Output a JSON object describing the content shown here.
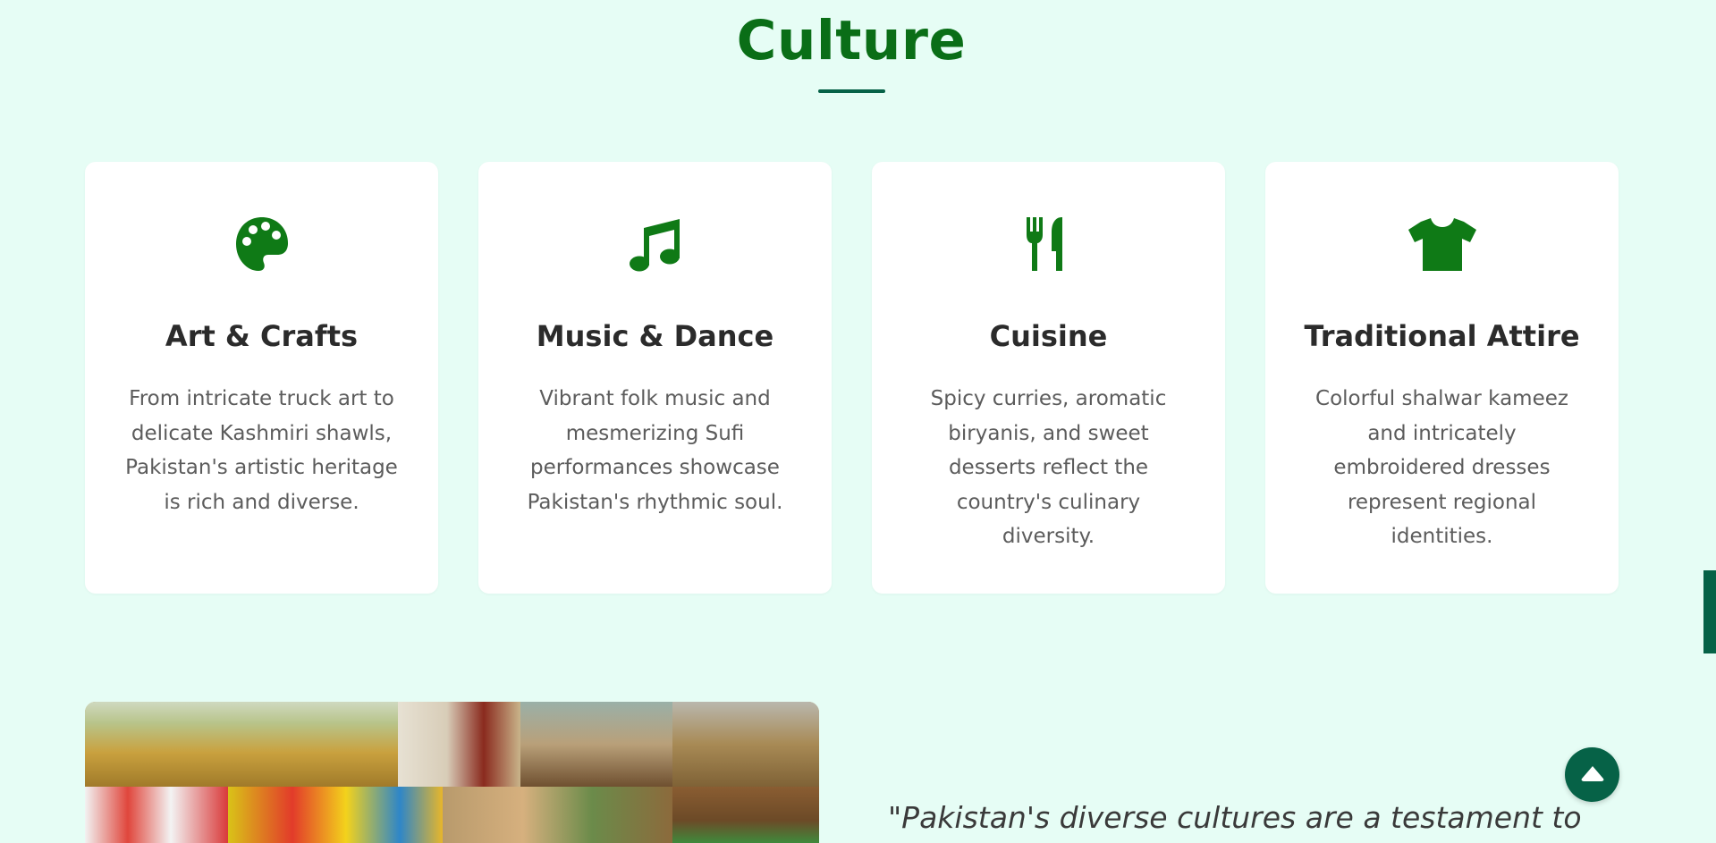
{
  "culture_section": {
    "title": "Culture",
    "colors": {
      "title": "#0a6e17",
      "accent": "#066247",
      "icon": "#0f7a16",
      "background": "#e6fdf5",
      "card": "#ffffff"
    },
    "cards": [
      {
        "icon": "palette-icon",
        "title": "Art & Crafts",
        "text": "From intricate truck art to delicate Kashmiri shawls, Pakistan's artistic heritage is rich and diverse."
      },
      {
        "icon": "music-note-icon",
        "title": "Music & Dance",
        "text": "Vibrant folk music and mesmerizing Sufi performances showcase Pakistan's rhythmic soul."
      },
      {
        "icon": "utensils-icon",
        "title": "Cuisine",
        "text": "Spicy curries, aromatic biryanis, and sweet desserts reflect the country's culinary diversity."
      },
      {
        "icon": "tshirt-icon",
        "title": "Traditional Attire",
        "text": "Colorful shalwar kameez and intricately embroidered dresses represent regional identities."
      }
    ]
  },
  "quote_section": {
    "quote_text": "\"Pakistan's diverse cultures are a testament to"
  },
  "floating": {
    "scroll_top_icon": "chevron-up-icon"
  }
}
